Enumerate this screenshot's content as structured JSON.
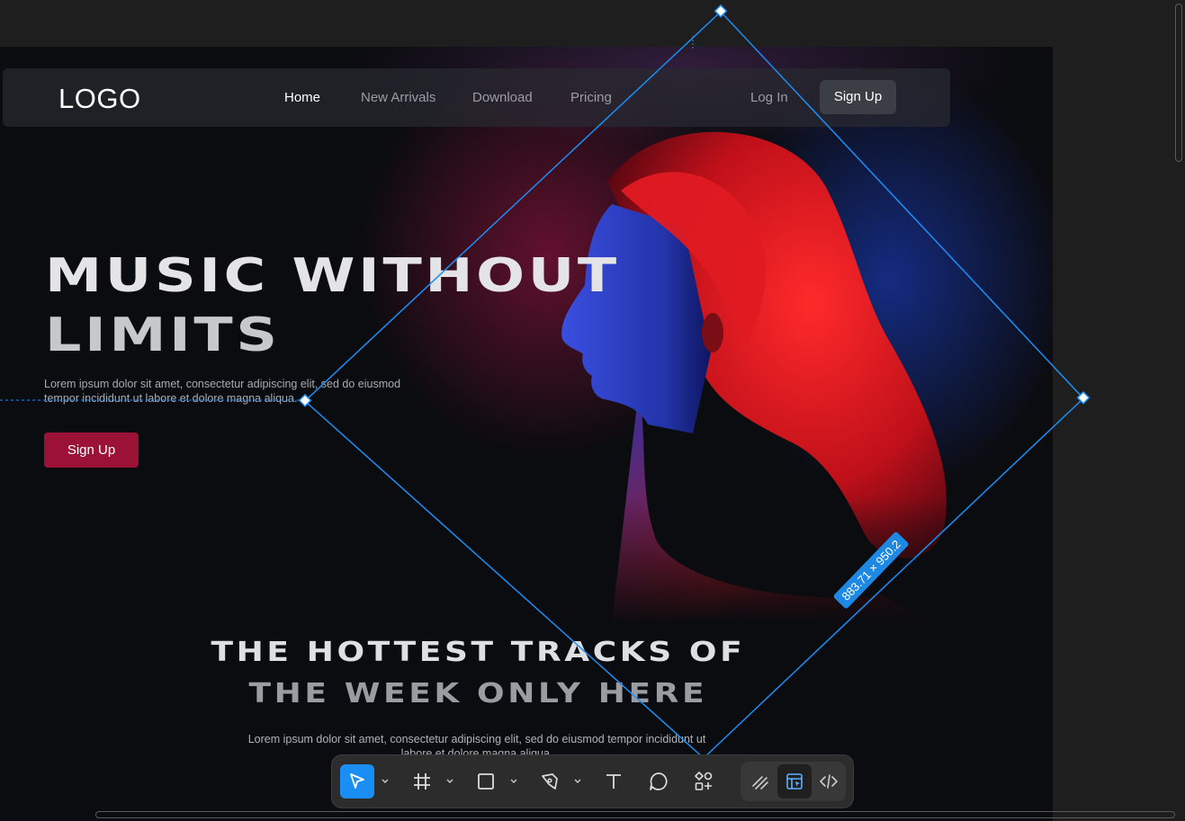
{
  "nav": {
    "logo": "LOGO",
    "links": [
      "Home",
      "New Arrivals",
      "Download",
      "Pricing"
    ],
    "login": "Log In",
    "signup": "Sign Up"
  },
  "hero": {
    "title_line1": "MUSIC WITHOUT",
    "title_line2": "LIMITS",
    "subtitle_line1": "Lorem ipsum dolor sit amet, consectetur adipiscing elit, sed do eiusmod",
    "subtitle_line2": "tempor incididunt ut labore et dolore magna aliqua.",
    "cta": "Sign Up"
  },
  "section": {
    "title_line1": "THE HOTTEST TRACKS OF",
    "title_line2": "THE WEEK ONLY HERE",
    "text_line1": "Lorem ipsum dolor sit amet, consectetur adipiscing elit, sed do eiusmod tempor incididunt ut",
    "text_line2": "labore et dolore magna aliqua."
  },
  "selection": {
    "dimensions": "883.71 × 950.2"
  },
  "toolbar": {
    "tools": [
      "move-icon",
      "frame-icon",
      "rectangle-icon",
      "pen-icon",
      "text-icon",
      "comment-icon",
      "actions-icon",
      "draw-icon",
      "design-icon",
      "dev-mode-icon"
    ]
  },
  "colors": {
    "accent": "#1b8ef5",
    "cta": "#9b1236",
    "background": "#0b0c10"
  }
}
